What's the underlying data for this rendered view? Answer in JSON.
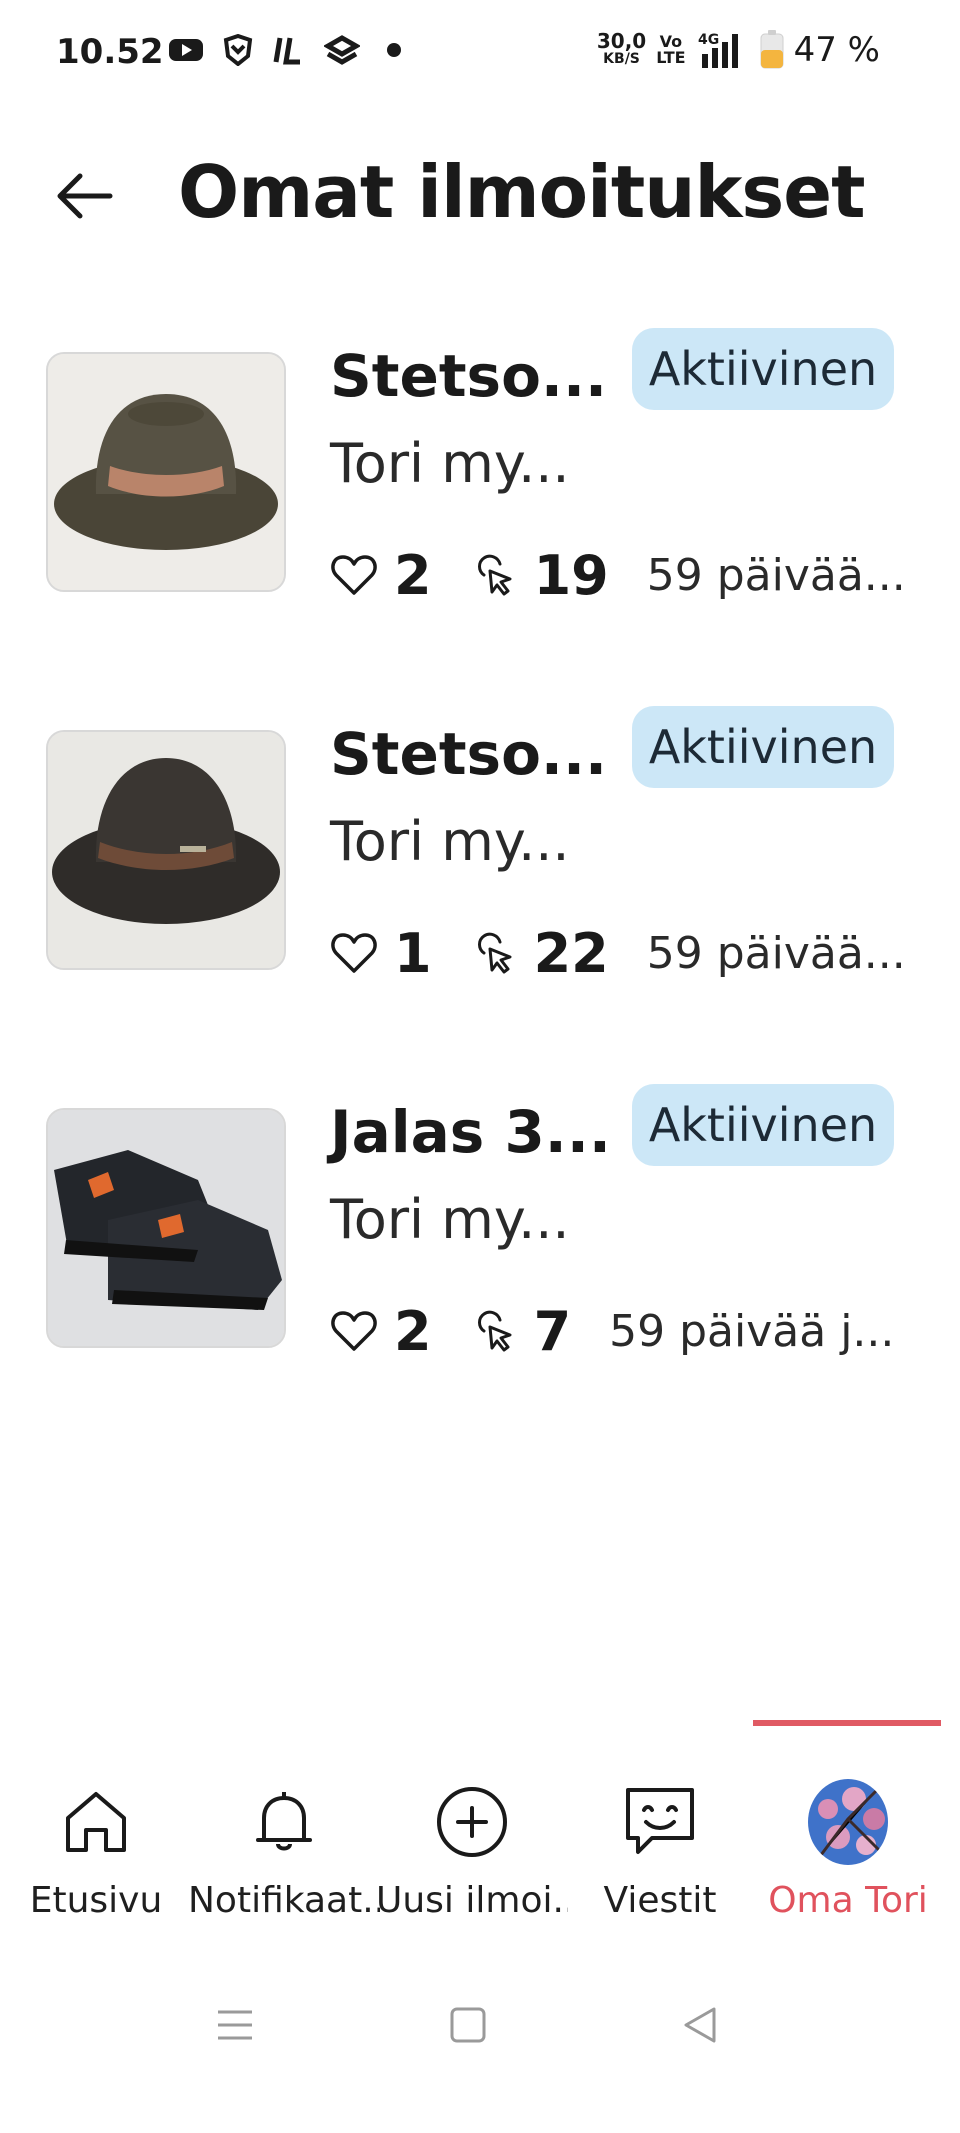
{
  "status_bar": {
    "time": "10.52",
    "net_speed": "30,0",
    "net_speed_unit": "KB/S",
    "volte_top": "Vo",
    "volte_bottom": "LTE",
    "network": "4G",
    "battery": "47 %"
  },
  "header": {
    "title": "Omat ilmoitukset",
    "back_icon": "arrow-left-icon"
  },
  "listings": [
    {
      "title": "Stetso...",
      "status": "Aktiivinen",
      "subtitle": "Tori my...",
      "likes": "2",
      "clicks": "19",
      "days": "59 päivää...",
      "image": "brown-hat-with-band"
    },
    {
      "title": "Stetso...",
      "status": "Aktiivinen",
      "subtitle": "Tori my...",
      "likes": "1",
      "clicks": "22",
      "days": "59 päivää...",
      "image": "dark-hat-with-band"
    },
    {
      "title": "Jalas 3...",
      "status": "Aktiivinen",
      "subtitle": "Tori my...",
      "likes": "2",
      "clicks": "7",
      "days": "59 päivää j...",
      "image": "black-safety-sandals"
    }
  ],
  "bottom_nav": {
    "items": [
      {
        "label": "Etusivu",
        "icon": "home-icon"
      },
      {
        "label": "Notifikaat...",
        "icon": "bell-icon"
      },
      {
        "label": "Uusi ilmoi...",
        "icon": "plus-circle-icon"
      },
      {
        "label": "Viestit",
        "icon": "chat-icon"
      },
      {
        "label": "Oma Tori",
        "icon": "avatar-icon"
      }
    ],
    "active_index": 4
  },
  "colors": {
    "accent": "#e0525d",
    "badge_bg": "#cce7f7"
  }
}
